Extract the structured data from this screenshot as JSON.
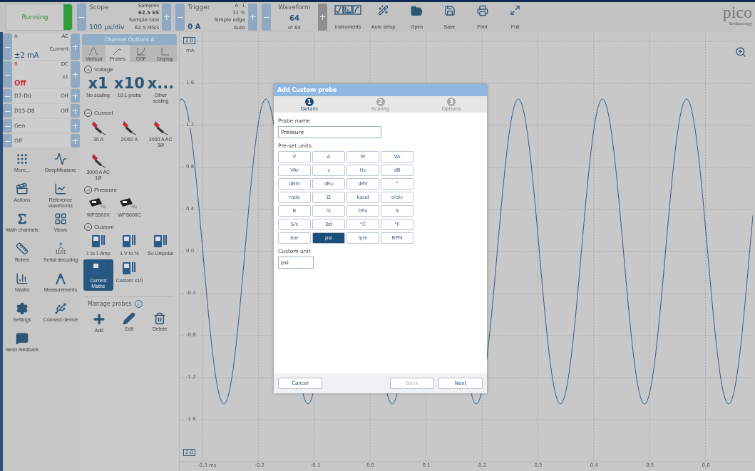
{
  "toolbar": {
    "run_button": {
      "label": "Running",
      "on": true
    },
    "scope": {
      "minus": "−",
      "title": "Scope",
      "value": "100 µs/div",
      "samples_label": "Samples",
      "samples": "62.5 kS",
      "rate_label": "Sample rate",
      "rate": "62.5 MS/s",
      "plus": "+"
    },
    "trigger": {
      "minus": "−",
      "title": "Trigger",
      "value": "0 A",
      "channel": "A",
      "mode_letter": "L",
      "level": "31 %",
      "type": "Simple edge",
      "mode": "Auto",
      "plus": "+"
    },
    "waveform": {
      "minus": "−",
      "title": "Waveform",
      "value": "64",
      "of": "of 64",
      "plus": "+",
      "plus_disabled": true
    },
    "tools": [
      {
        "label": "Instruments"
      },
      {
        "label": "Auto setup"
      },
      {
        "label": "Open"
      },
      {
        "label": "Save"
      },
      {
        "label": "Print"
      },
      {
        "label": "Full"
      }
    ],
    "logo": {
      "name": "pico",
      "tagline": "Technology"
    }
  },
  "channels": [
    {
      "kind": "analog",
      "minus": "−",
      "name": "A",
      "coupling": "AC",
      "probe": "Current",
      "range": "±2 mA",
      "plus": "+",
      "enabled": true
    },
    {
      "kind": "analog",
      "minus": "−",
      "name": "B",
      "coupling": "DC",
      "probe": "x1",
      "range": "Off",
      "plus": "+",
      "enabled": false
    },
    {
      "kind": "digital",
      "minus": "−",
      "name": "D7-D0",
      "state": "Off",
      "plus": "+"
    },
    {
      "kind": "digital",
      "minus": "−",
      "name": "D15-D8",
      "state": "Off",
      "plus": "+"
    },
    {
      "kind": "digital",
      "minus": "−",
      "name": "Gen",
      "plus": "+"
    },
    {
      "kind": "digital",
      "minus": "−",
      "name": "Off",
      "plus": "+"
    }
  ],
  "tools": [
    {
      "label": "More..."
    },
    {
      "label": "DeepMeasure"
    },
    {
      "label": "Actions"
    },
    {
      "label": "Reference waveforms"
    },
    {
      "label": "Math channels"
    },
    {
      "label": "Views"
    },
    {
      "label": "Rulers"
    },
    {
      "label": "Serial decoding"
    },
    {
      "label": "Masks"
    },
    {
      "label": "Measurements"
    },
    {
      "label": "Settings"
    },
    {
      "label": "Connect device"
    },
    {
      "label": "Send feedback"
    }
  ],
  "serial_icon_text": "1101",
  "channel_options": {
    "title": "Channel Options  A",
    "tabs": [
      {
        "label": "Vertical",
        "selected": false
      },
      {
        "label": "Probes",
        "selected": true
      },
      {
        "label": "DSP",
        "selected": false
      },
      {
        "label": "Display",
        "selected": false
      }
    ],
    "sections": [
      {
        "title": "Voltage",
        "expanded": true,
        "kind": "scaling",
        "items": [
          {
            "big": "x1",
            "label": "No scaling",
            "selected": false
          },
          {
            "big": "x10",
            "label": "10:1 probe",
            "selected": false
          },
          {
            "big": "x...",
            "label": "Other scaling",
            "selected": false
          }
        ]
      },
      {
        "title": "Current",
        "expanded": true,
        "kind": "clamp",
        "items": [
          {
            "label": "30 A",
            "selected": false
          },
          {
            "label": "20/60 A",
            "selected": false
          },
          {
            "label": "3000 A AC 3Ø",
            "selected": false
          },
          {
            "label": "3000 A AC 1Ø",
            "selected": false
          }
        ]
      },
      {
        "title": "Pressure",
        "expanded": true,
        "kind": "sensor",
        "items": [
          {
            "label": "WPS500X",
            "selected": false
          },
          {
            "label": "WPS600C",
            "selected": false
          }
        ]
      },
      {
        "title": "Custom",
        "expanded": true,
        "kind": "meter",
        "items": [
          {
            "label": "1 to 1 Amp",
            "selected": false
          },
          {
            "label": "1 V to %",
            "selected": false
          },
          {
            "label": "5V-Unipolar",
            "selected": false
          },
          {
            "label": "Current Maths",
            "selected": true
          },
          {
            "label": "Custom x10",
            "selected": false
          }
        ]
      }
    ],
    "manage": {
      "title": "Manage probes",
      "info": "i",
      "actions": [
        {
          "label": "Add"
        },
        {
          "label": "Edit"
        },
        {
          "label": "Delete"
        }
      ]
    }
  },
  "plot": {
    "unit": "mA",
    "y_ticks": [
      "2.0",
      "1.6",
      "1.2",
      "0.8",
      "0.4",
      "0.0",
      "-0.4",
      "-0.8",
      "-1.2",
      "-1.6",
      "2.0"
    ],
    "x_ticks": [
      "-0.3 ms",
      "-0.2",
      "-0.1",
      "0.0",
      "0.1",
      "0.2",
      "0.3",
      "0.4",
      "0.5",
      "0.6"
    ]
  },
  "dialog": {
    "title": "Add Custom probe",
    "steps": [
      {
        "number": "1",
        "label": "Details",
        "selected": true
      },
      {
        "number": "2",
        "label": "Scaling",
        "selected": false
      },
      {
        "number": "3",
        "label": "Options",
        "selected": false
      }
    ],
    "name_label": "Probe name",
    "name_value": "Pressure",
    "units_label": "Pre-set units",
    "units": [
      {
        "label": "V",
        "selected": false
      },
      {
        "label": "A",
        "selected": false
      },
      {
        "label": "W",
        "selected": false
      },
      {
        "label": "VA",
        "selected": false
      },
      {
        "label": "VAr",
        "selected": false
      },
      {
        "label": "s",
        "selected": false
      },
      {
        "label": "Hz",
        "selected": false
      },
      {
        "label": "dB",
        "selected": false
      },
      {
        "label": "dBm",
        "selected": false
      },
      {
        "label": "dBu",
        "selected": false
      },
      {
        "label": "dBV",
        "selected": false
      },
      {
        "label": "°",
        "selected": false
      },
      {
        "label": "rads",
        "selected": false
      },
      {
        "label": "Ω",
        "selected": false
      },
      {
        "label": "baud",
        "selected": false
      },
      {
        "label": "s/div",
        "selected": false
      },
      {
        "label": "B",
        "selected": false
      },
      {
        "label": "%",
        "selected": false
      },
      {
        "label": "hPa",
        "selected": false
      },
      {
        "label": "S",
        "selected": false
      },
      {
        "label": "S/s",
        "selected": false
      },
      {
        "label": "Bd",
        "selected": false
      },
      {
        "label": "°C",
        "selected": false
      },
      {
        "label": "°F",
        "selected": false
      },
      {
        "label": "bar",
        "selected": false
      },
      {
        "label": "psi",
        "selected": true
      },
      {
        "label": "lpm",
        "selected": false
      },
      {
        "label": "RPM",
        "selected": false
      }
    ],
    "custom_label": "Custom unit",
    "custom_value": "psi",
    "buttons": [
      {
        "label": "Cancel",
        "disabled": false
      },
      {
        "label": "Back",
        "disabled": true
      },
      {
        "label": "Next",
        "disabled": false
      }
    ]
  }
}
